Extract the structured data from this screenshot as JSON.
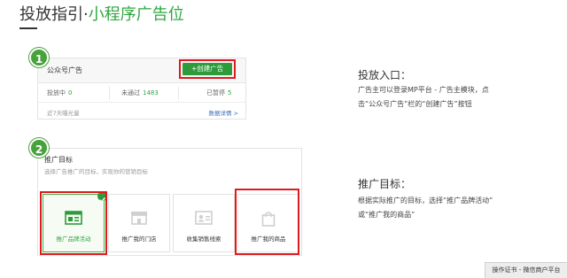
{
  "header": {
    "title_prefix": "投放指引·",
    "title_highlight": "小程序广告位"
  },
  "step1": {
    "number": "1",
    "panel_title": "公众号广告",
    "create_button": "+创建广告",
    "stats": [
      {
        "label": "投放中",
        "value": "0"
      },
      {
        "label": "未通过",
        "value": "1483"
      },
      {
        "label": "已暂停",
        "value": "5"
      }
    ],
    "footer_left": "近7天曝光量",
    "footer_right": "数据详情 >"
  },
  "step2": {
    "number": "2",
    "panel_title": "推广目标",
    "panel_subtitle": "选择广告推广的目标，实现你的营销目标",
    "cards": [
      {
        "label": "推广品牌活动",
        "icon": "browser-icon",
        "selected": true
      },
      {
        "label": "推广我的门店",
        "icon": "store-icon",
        "selected": false
      },
      {
        "label": "收集销售线索",
        "icon": "contact-card-icon",
        "selected": false
      },
      {
        "label": "推广我的商品",
        "icon": "shopping-bag-icon",
        "selected": false
      }
    ]
  },
  "right": {
    "section1_heading": "投放入口：",
    "section1_line1": "广告主可以登录MP平台 - 广告主模块，点",
    "section1_line2": "击“公众号广告”栏的“创建广告”按钮",
    "section2_heading": "推广目标：",
    "section2_line1": "根据实际推广的目标，选择“推广品牌活动”",
    "section2_line2": "或“推广我的商品”"
  },
  "corner_tag": "操作证书 - 微信商户平台",
  "colors": {
    "accent_green": "#2fa640",
    "button_green": "#2d9b3a",
    "highlight_red": "#e0191f"
  }
}
